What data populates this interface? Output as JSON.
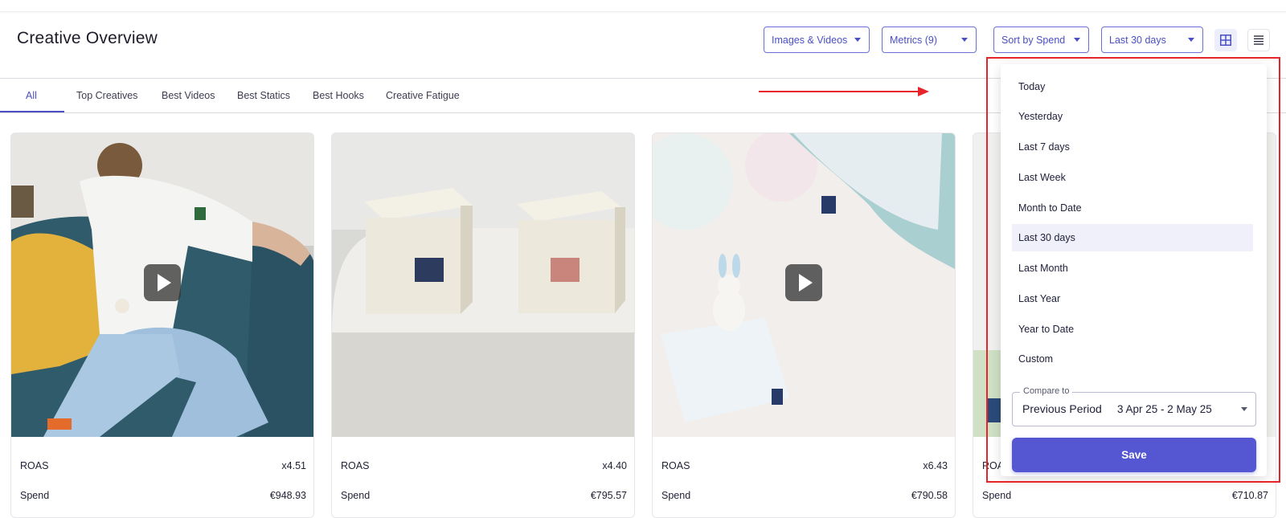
{
  "page": {
    "title": "Creative Overview"
  },
  "filters": {
    "media": "Images & Videos",
    "metrics": "Metrics (9)",
    "sort": "Sort by Spend",
    "date_range": "Last 30 days"
  },
  "view_toggle": {
    "grid_icon": "grid-icon",
    "list_icon": "list-icon",
    "active": "grid"
  },
  "tabs": [
    {
      "label": "All",
      "active": true
    },
    {
      "label": "Top Creatives"
    },
    {
      "label": "Best Videos"
    },
    {
      "label": "Best Statics"
    },
    {
      "label": "Best Hooks"
    },
    {
      "label": "Creative Fatigue"
    }
  ],
  "cards": [
    {
      "type": "video",
      "metrics": [
        {
          "label": "ROAS",
          "value": "x4.51"
        },
        {
          "label": "Spend",
          "value": "€948.93"
        }
      ]
    },
    {
      "type": "image",
      "metrics": [
        {
          "label": "ROAS",
          "value": "x4.40"
        },
        {
          "label": "Spend",
          "value": "€795.57"
        }
      ]
    },
    {
      "type": "video",
      "metrics": [
        {
          "label": "ROAS",
          "value": "x6.43"
        },
        {
          "label": "Spend",
          "value": "€790.58"
        }
      ]
    },
    {
      "type": "image",
      "metrics": [
        {
          "label": "ROA",
          "value": ""
        },
        {
          "label": "Spend",
          "value": "€710.87"
        }
      ]
    }
  ],
  "date_menu": {
    "options": [
      "Today",
      "Yesterday",
      "Last 7 days",
      "Last Week",
      "Month to Date",
      "Last 30 days",
      "Last Month",
      "Last Year",
      "Year to Date",
      "Custom"
    ],
    "selected": "Last 30 days",
    "compare": {
      "label": "Compare to",
      "value": "Previous Period",
      "range": "3 Apr 25 - 2 May 25"
    },
    "save_label": "Save"
  },
  "colors": {
    "accent": "#4a4fc4",
    "save_button": "#5457d1",
    "annotation": "#e8242b"
  }
}
